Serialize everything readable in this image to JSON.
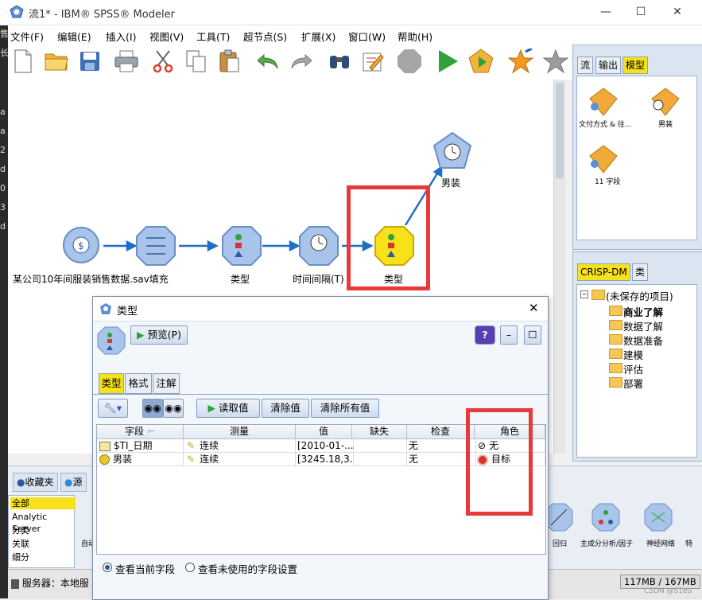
{
  "window": {
    "title": "流1* - IBM® SPSS® Modeler",
    "minimize": "—",
    "maximize": "☐",
    "close": "✕"
  },
  "gutter": [
    "1",
    "售",
    "长",
    "a",
    "a",
    "2",
    "d",
    "0",
    "3",
    "d"
  ],
  "menus": [
    "文件(F)",
    "编辑(E)",
    "插入(I)",
    "视图(V)",
    "工具(T)",
    "超节点(S)",
    "扩展(X)",
    "窗口(W)",
    "帮助(H)"
  ],
  "toolbar_icons": [
    "new-icon",
    "open-icon",
    "save-icon",
    "print-icon",
    "cut-icon",
    "copy-icon",
    "paste-icon",
    "undo-icon",
    "redo-icon",
    "find-icon",
    "edit-icon",
    "stop-icon",
    "run-icon",
    "run-selection-icon",
    "favorite-icon",
    "star-icon"
  ],
  "canvas": {
    "nodes": [
      {
        "label": "某公司10年间服装销售数据.sav填充"
      },
      {
        "label": ""
      },
      {
        "label": "类型"
      },
      {
        "label": "时间间隔(T)"
      },
      {
        "label": "类型"
      },
      {
        "label": "男装"
      }
    ]
  },
  "right_panel": {
    "tabs": [
      "流",
      "输出",
      "模型"
    ],
    "models": [
      {
        "label": "文付方式 & 往..."
      },
      {
        "label": "男装"
      },
      {
        "label": "11 字段"
      }
    ]
  },
  "crisp": {
    "tabs": [
      "CRISP-DM",
      "类"
    ],
    "root": "(未保存的项目)",
    "items": [
      "商业了解",
      "数据了解",
      "数据准备",
      "建模",
      "评估",
      "部署"
    ]
  },
  "palette": {
    "tabs": [
      "收藏夹",
      "源"
    ],
    "categories": [
      "全部",
      "Analytic Server",
      "分类",
      "关联",
      "细分"
    ],
    "visible_nodes": [
      "自动",
      "回归",
      "主成分分析/因子",
      "神经网络",
      "特"
    ]
  },
  "status": {
    "server": "服务器：本地服",
    "memory": "117MB / 167MB"
  },
  "watermark": "CSDN @S1eu",
  "dialog": {
    "title": "类型",
    "preview_button": "预览(P)",
    "tabs": [
      "类型",
      "格式",
      "注解"
    ],
    "read_values": "读取值",
    "clear_values": "清除值",
    "clear_all_values": "清除所有值",
    "columns": [
      "字段",
      "测量",
      "值",
      "缺失",
      "检查",
      "角色"
    ],
    "rows": [
      {
        "field": "$TI_日期",
        "measure": "连续",
        "value": "[2010-01-...",
        "missing": "",
        "check": "无",
        "role": "无"
      },
      {
        "field": "男装",
        "measure": "连续",
        "value": "[3245.18,3...",
        "missing": "",
        "check": "无",
        "role": "目标"
      }
    ],
    "radio_current": "查看当前字段",
    "radio_unused": "查看未使用的字段设置"
  },
  "colors": {
    "highlight_red": "#e8393a",
    "canvas_arrow": "#1f6fc8",
    "node_blue": "#a9c4ea",
    "node_yellow": "#f7e11a"
  }
}
